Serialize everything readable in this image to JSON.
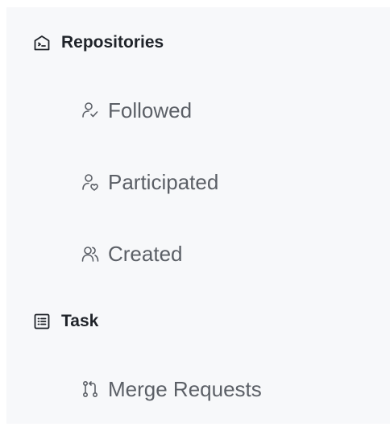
{
  "sidebar": {
    "groups": [
      {
        "label": "Repositories",
        "icon": "repository-icon",
        "items": [
          {
            "label": "Followed",
            "icon": "followed-user-icon"
          },
          {
            "label": "Participated",
            "icon": "participated-user-icon"
          },
          {
            "label": "Created",
            "icon": "created-users-icon"
          }
        ]
      },
      {
        "label": "Task",
        "icon": "task-list-icon",
        "items": [
          {
            "label": "Merge Requests",
            "icon": "merge-request-icon"
          }
        ]
      }
    ]
  },
  "colors": {
    "background": "#f7f8fa",
    "group_text": "#1f2329",
    "item_text": "#5b5f66"
  }
}
